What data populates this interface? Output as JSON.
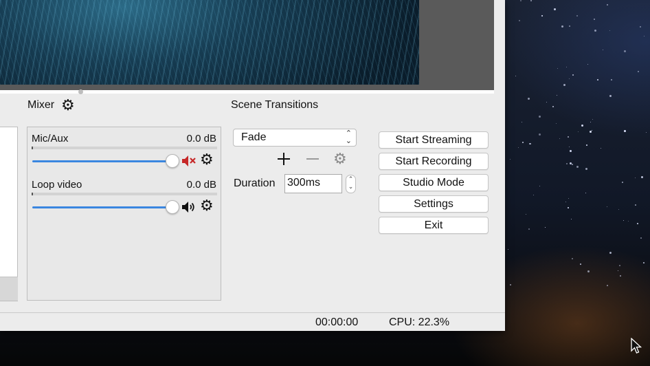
{
  "mixer": {
    "title": "Mixer",
    "title_icon": "gear-icon",
    "channels": [
      {
        "name": "Mic/Aux",
        "level": "0.0 dB",
        "volume_fraction": 1.0,
        "muted": true,
        "mute_icon": "speaker-muted-icon",
        "settings_icon": "gear-icon"
      },
      {
        "name": "Loop video",
        "level": "0.0 dB",
        "volume_fraction": 1.0,
        "muted": false,
        "mute_icon": "speaker-icon",
        "settings_icon": "gear-icon"
      }
    ]
  },
  "transitions": {
    "title": "Scene Transitions",
    "selected": "Fade",
    "add_icon": "plus-icon",
    "remove_icon": "minus-icon",
    "settings_icon": "gear-icon",
    "duration_label": "Duration",
    "duration_value": "300ms"
  },
  "controls": {
    "start_streaming": "Start Streaming",
    "start_recording": "Start Recording",
    "studio_mode": "Studio Mode",
    "settings": "Settings",
    "exit": "Exit"
  },
  "status": {
    "time": "00:00:00",
    "cpu": "CPU: 22.3%"
  },
  "colors": {
    "slider": "#3a86e0",
    "muted_icon": "#c62828",
    "window_bg": "#ececec"
  }
}
